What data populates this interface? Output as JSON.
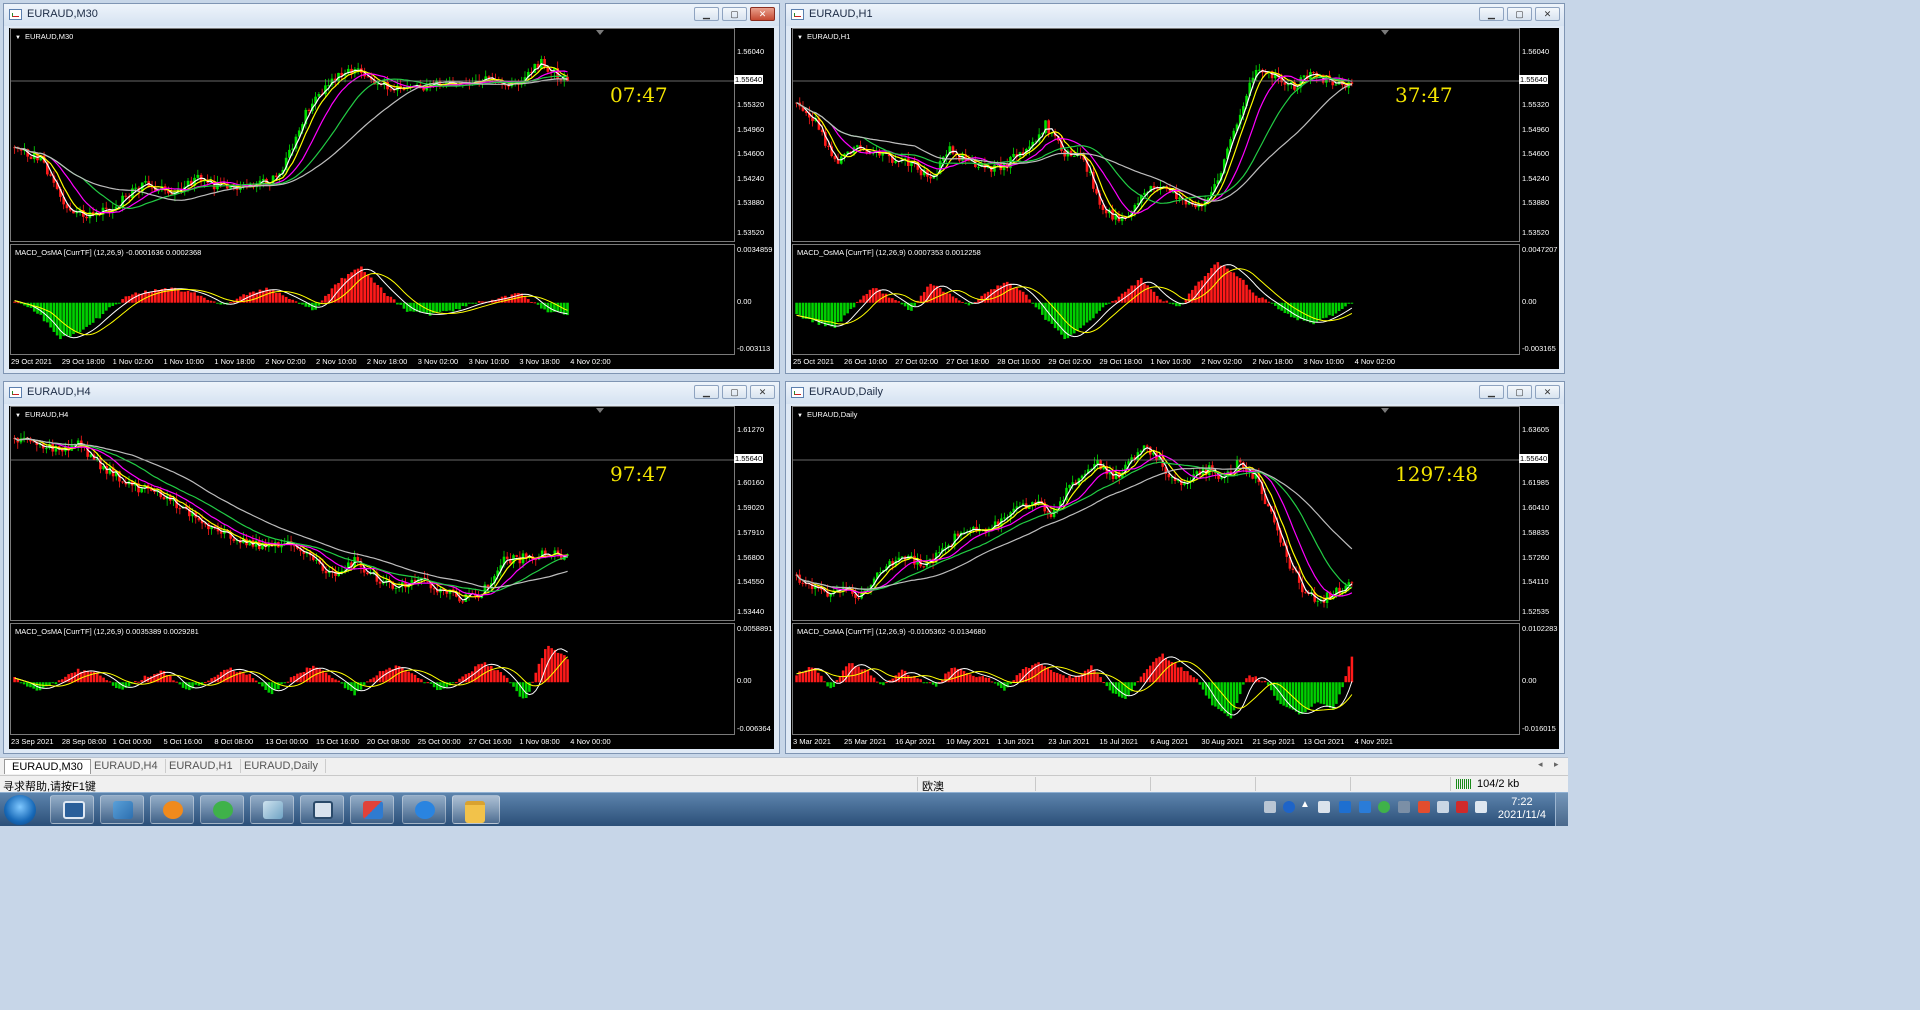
{
  "status_bar": {
    "help_text": "寻求帮助,请按F1键",
    "profile": "欧澳",
    "traffic": "104/2 kb"
  },
  "taskbar": {
    "time": "7:22",
    "date": "2021/11/4"
  },
  "tabs": [
    {
      "label": "EURAUD,M30",
      "active": true
    },
    {
      "label": "EURAUD,H4",
      "active": false
    },
    {
      "label": "EURAUD,H1",
      "active": false
    },
    {
      "label": "EURAUD,Daily",
      "active": false
    }
  ],
  "windows": [
    {
      "title": "EURAUD,M30",
      "symbol_label": "EURAUD,M30",
      "timer": "07:47",
      "active": true,
      "price_ticks": [
        "1.56040",
        "1.55320",
        "1.54960",
        "1.54600",
        "1.54240",
        "1.53880",
        "1.53520"
      ],
      "current_price": "1.55640",
      "macd_label": "MACD_OsMA [CurrTF] (12,26,9) -0.0001636 0.0002368",
      "macd_ticks": [
        "0.0034859",
        "0.00",
        "-0.003113"
      ],
      "time_ticks": [
        "29 Oct 2021",
        "29 Oct 18:00",
        "1 Nov 02:00",
        "1 Nov 10:00",
        "1 Nov 18:00",
        "2 Nov 02:00",
        "2 Nov 10:00",
        "2 Nov 18:00",
        "3 Nov 02:00",
        "3 Nov 10:00",
        "3 Nov 18:00",
        "4 Nov 02:00"
      ]
    },
    {
      "title": "EURAUD,H1",
      "symbol_label": "EURAUD,H1",
      "timer": "37:47",
      "active": false,
      "price_ticks": [
        "1.56040",
        "1.55320",
        "1.54960",
        "1.54600",
        "1.54240",
        "1.53880",
        "1.53520"
      ],
      "current_price": "1.55640",
      "macd_label": "MACD_OsMA [CurrTF] (12,26,9) 0.0007353 0.0012258",
      "macd_ticks": [
        "0.0047207",
        "0.00",
        "-0.003165"
      ],
      "time_ticks": [
        "25 Oct 2021",
        "26 Oct 10:00",
        "27 Oct 02:00",
        "27 Oct 18:00",
        "28 Oct 10:00",
        "29 Oct 02:00",
        "29 Oct 18:00",
        "1 Nov 10:00",
        "2 Nov 02:00",
        "2 Nov 18:00",
        "3 Nov 10:00",
        "4 Nov 02:00"
      ]
    },
    {
      "title": "EURAUD,H4",
      "symbol_label": "EURAUD,H4",
      "timer": "97:47",
      "active": false,
      "price_ticks": [
        "1.61270",
        "1.60160",
        "1.59020",
        "1.57910",
        "1.56800",
        "1.54550",
        "1.53440"
      ],
      "current_price": "1.55640",
      "macd_label": "MACD_OsMA [CurrTF] (12,26,9) 0.0035389 0.0029281",
      "macd_ticks": [
        "0.0058891",
        "0.00",
        "-0.006364"
      ],
      "time_ticks": [
        "23 Sep 2021",
        "28 Sep 08:00",
        "1 Oct 00:00",
        "5 Oct 16:00",
        "8 Oct 08:00",
        "13 Oct 00:00",
        "15 Oct 16:00",
        "20 Oct 08:00",
        "25 Oct 00:00",
        "27 Oct 16:00",
        "1 Nov 08:00",
        "4 Nov 00:00"
      ]
    },
    {
      "title": "EURAUD,Daily",
      "symbol_label": "EURAUD,Daily",
      "timer": "1297:48",
      "active": false,
      "price_ticks": [
        "1.63605",
        "1.61985",
        "1.60410",
        "1.58835",
        "1.57260",
        "1.54110",
        "1.52535"
      ],
      "current_price": "1.55640",
      "macd_label": "MACD_OsMA [CurrTF] (12,26,9) -0.0105362 -0.0134680",
      "macd_ticks": [
        "0.0102283",
        "0.00",
        "-0.016015"
      ],
      "time_ticks": [
        "3 Mar 2021",
        "25 Mar 2021",
        "16 Apr 2021",
        "10 May 2021",
        "1 Jun 2021",
        "23 Jun 2021",
        "15 Jul 2021",
        "6 Aug 2021",
        "30 Aug 2021",
        "21 Sep 2021",
        "13 Oct 2021",
        "4 Nov 2021"
      ]
    }
  ]
}
